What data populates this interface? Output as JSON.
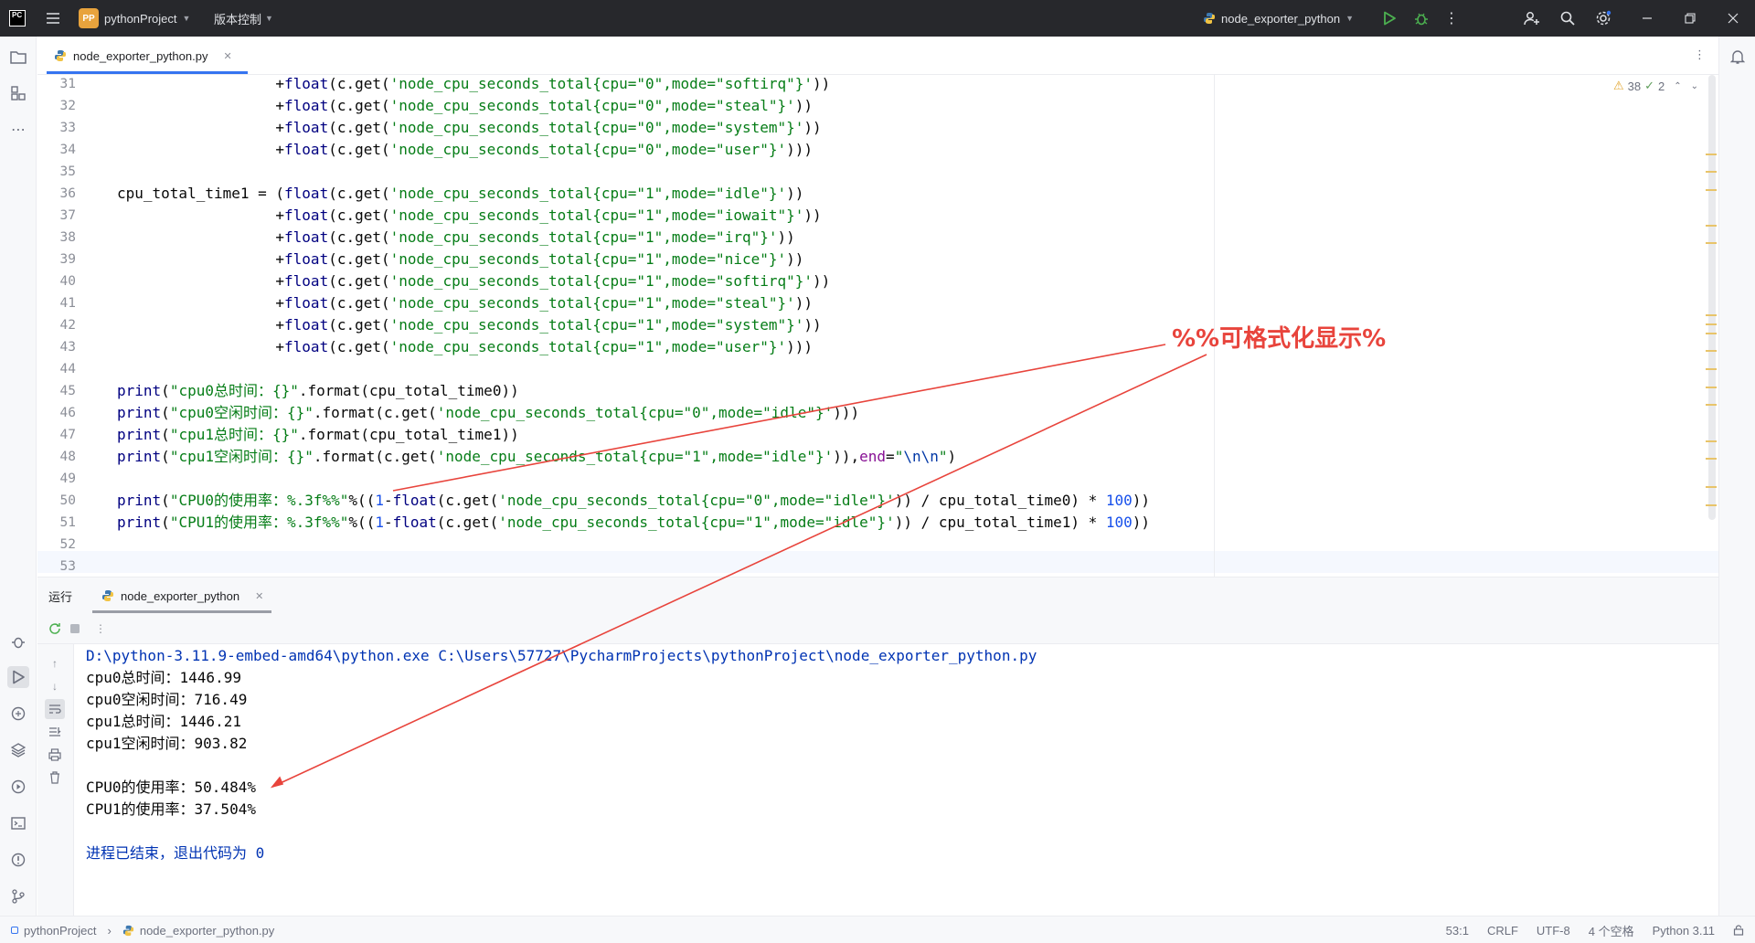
{
  "titlebar": {
    "project_badge": "PP",
    "project_name": "pythonProject",
    "vcs_label": "版本控制",
    "run_config": "node_exporter_python"
  },
  "editor": {
    "tab_label": "node_exporter_python.py",
    "inspection": {
      "warnings": "38",
      "weak_warnings": "2"
    },
    "line_numbers": [
      "31",
      "32",
      "33",
      "34",
      "35",
      "36",
      "37",
      "38",
      "39",
      "40",
      "41",
      "42",
      "43",
      "44",
      "45",
      "46",
      "47",
      "48",
      "49",
      "50",
      "51",
      "52",
      "53"
    ],
    "lines": {
      "l31": {
        "pre": "                  +",
        "fn": "float",
        "a": "(c.get(",
        "s": "'node_cpu_seconds_total{cpu=\"0\",mode=\"softirq\"}'",
        "b": "))"
      },
      "l32": {
        "pre": "                  +",
        "fn": "float",
        "a": "(c.get(",
        "s": "'node_cpu_seconds_total{cpu=\"0\",mode=\"steal\"}'",
        "b": "))"
      },
      "l33": {
        "pre": "                  +",
        "fn": "float",
        "a": "(c.get(",
        "s": "'node_cpu_seconds_total{cpu=\"0\",mode=\"system\"}'",
        "b": "))"
      },
      "l34": {
        "pre": "                  +",
        "fn": "float",
        "a": "(c.get(",
        "s": "'node_cpu_seconds_total{cpu=\"0\",mode=\"user\"}'",
        "b": ")))"
      },
      "l36": {
        "pre": "cpu_total_time1 = (",
        "fn": "float",
        "a": "(c.get(",
        "s": "'node_cpu_seconds_total{cpu=\"1\",mode=\"idle\"}'",
        "b": "))"
      },
      "l37": {
        "pre": "                  +",
        "fn": "float",
        "a": "(c.get(",
        "s": "'node_cpu_seconds_total{cpu=\"1\",mode=\"iowait\"}'",
        "b": "))"
      },
      "l38": {
        "pre": "                  +",
        "fn": "float",
        "a": "(c.get(",
        "s": "'node_cpu_seconds_total{cpu=\"1\",mode=\"irq\"}'",
        "b": "))"
      },
      "l39": {
        "pre": "                  +",
        "fn": "float",
        "a": "(c.get(",
        "s": "'node_cpu_seconds_total{cpu=\"1\",mode=\"nice\"}'",
        "b": "))"
      },
      "l40": {
        "pre": "                  +",
        "fn": "float",
        "a": "(c.get(",
        "s": "'node_cpu_seconds_total{cpu=\"1\",mode=\"softirq\"}'",
        "b": "))"
      },
      "l41": {
        "pre": "                  +",
        "fn": "float",
        "a": "(c.get(",
        "s": "'node_cpu_seconds_total{cpu=\"1\",mode=\"steal\"}'",
        "b": "))"
      },
      "l42": {
        "pre": "                  +",
        "fn": "float",
        "a": "(c.get(",
        "s": "'node_cpu_seconds_total{cpu=\"1\",mode=\"system\"}'",
        "b": "))"
      },
      "l43": {
        "pre": "                  +",
        "fn": "float",
        "a": "(c.get(",
        "s": "'node_cpu_seconds_total{cpu=\"1\",mode=\"user\"}'",
        "b": ")))"
      },
      "l45": {
        "fn": "print",
        "a": "(",
        "s": "\"cpu0总时间：{}\"",
        "b": ".format(cpu_total_time0))"
      },
      "l46": {
        "fn": "print",
        "a": "(",
        "s": "\"cpu0空闲时间：{}\"",
        "b": ".format(c.get(",
        "s2": "'node_cpu_seconds_total{cpu=\"0\",mode=\"idle\"}'",
        "c": ")))"
      },
      "l47": {
        "fn": "print",
        "a": "(",
        "s": "\"cpu1总时间：{}\"",
        "b": ".format(cpu_total_time1))"
      },
      "l48": {
        "fn": "print",
        "a": "(",
        "s": "\"cpu1空闲时间：{}\"",
        "b": ".format(c.get(",
        "s2": "'node_cpu_seconds_total{cpu=\"1\",mode=\"idle\"}'",
        "c": ")),",
        "kw": "end",
        "eq": "=",
        "s3a": "\"",
        "esc": "\\n\\n",
        "s3b": "\"",
        "d": ")"
      },
      "l50": {
        "fn": "print",
        "a": "(",
        "s": "\"CPU0的使用率：%.3f%%\"",
        "b": "%((",
        "n1": "1",
        "m": "-",
        "fn2": "float",
        "c": "(c.get(",
        "s2": "'node_cpu_seconds_total{cpu=\"0\",mode=\"idle\"}'",
        "d": ")) / cpu_total_time0) * ",
        "n2": "100",
        "e": "))"
      },
      "l51": {
        "fn": "print",
        "a": "(",
        "s": "\"CPU1的使用率：%.3f%%\"",
        "b": "%((",
        "n1": "1",
        "m": "-",
        "fn2": "float",
        "c": "(c.get(",
        "s2": "'node_cpu_seconds_total{cpu=\"1\",mode=\"idle\"}'",
        "d": ")) / cpu_total_time1) * ",
        "n2": "100",
        "e": "))"
      }
    }
  },
  "run_panel": {
    "title": "运行",
    "tab_label": "node_exporter_python"
  },
  "console": {
    "command": "D:\\python-3.11.9-embed-amd64\\python.exe C:\\Users\\57727\\PycharmProjects\\pythonProject\\node_exporter_python.py",
    "out1": "cpu0总时间：1446.99",
    "out2": "cpu0空闲时间：716.49",
    "out3": "cpu1总时间：1446.21",
    "out4": "cpu1空闲时间：903.82",
    "out5": "CPU0的使用率：50.484%",
    "out6": "CPU1的使用率：37.504%",
    "exit": "进程已结束，退出代码为 0"
  },
  "statusbar": {
    "project": "pythonProject",
    "file": "node_exporter_python.py",
    "position": "53:1",
    "line_sep": "CRLF",
    "encoding": "UTF-8",
    "indent": "4 个空格",
    "interpreter": "Python 3.11"
  },
  "annotation": {
    "label": "%%可格式化显示%",
    "color": "#e8443c"
  },
  "colors": {
    "accent": "#3574f0",
    "titlebar_bg": "#27282c",
    "string": "#067d17",
    "keyword": "#0033b3",
    "number": "#1750eb",
    "run_green": "#4cb050"
  }
}
